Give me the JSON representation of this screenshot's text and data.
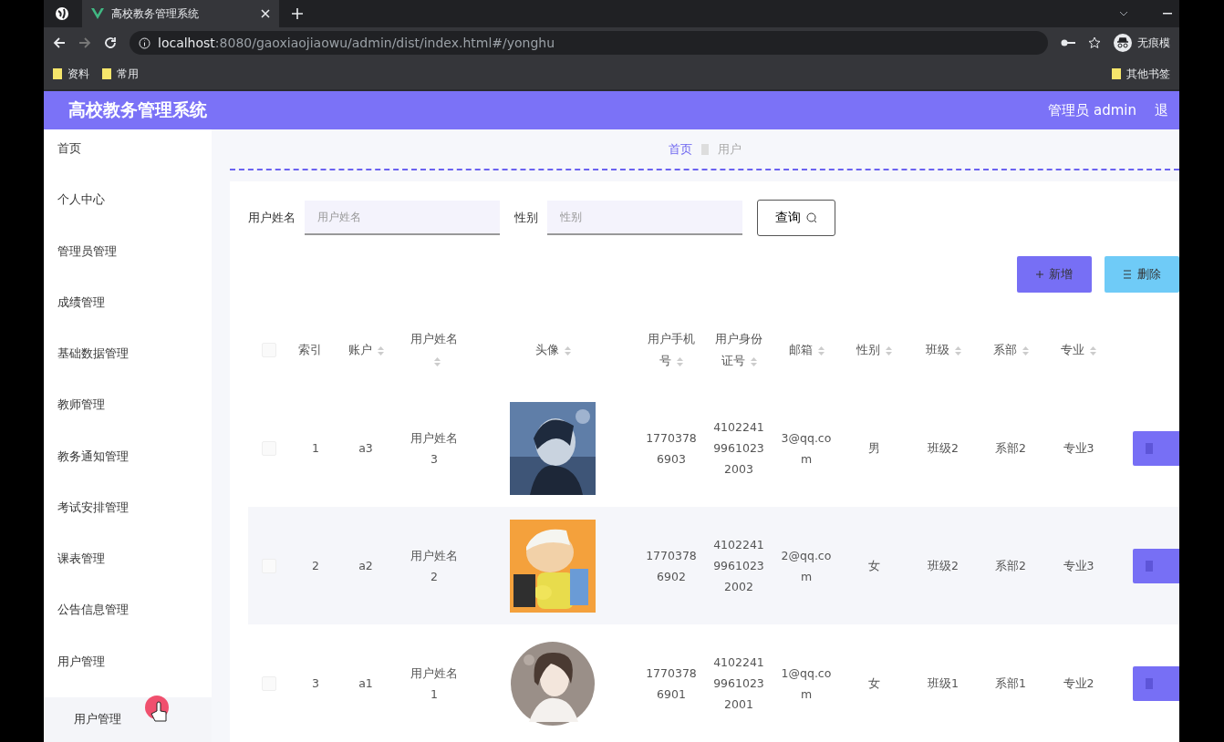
{
  "browser": {
    "tab_title": "高校教务管理系统",
    "url_host": "localhost",
    "url_path": ":8080/gaoxiaojiaowu/admin/dist/index.html#/yonghu",
    "bookmarks": [
      "资料",
      "常用"
    ],
    "other_bookmarks": "其他书签",
    "profile": "无痕模"
  },
  "header": {
    "title": "高校教务管理系统",
    "user": "管理员 admin",
    "logout": "退"
  },
  "sidebar": {
    "items": [
      {
        "label": "首页"
      },
      {
        "label": "个人中心"
      },
      {
        "label": "管理员管理"
      },
      {
        "label": "成绩管理"
      },
      {
        "label": "基础数据管理"
      },
      {
        "label": "教师管理"
      },
      {
        "label": "教务通知管理"
      },
      {
        "label": "考试安排管理"
      },
      {
        "label": "课表管理"
      },
      {
        "label": "公告信息管理"
      },
      {
        "label": "用户管理",
        "children": [
          {
            "label": "用户管理"
          }
        ]
      }
    ]
  },
  "breadcrumb": [
    "首页",
    "用户"
  ],
  "search": {
    "fields": [
      {
        "label": "用户姓名",
        "placeholder": "用户姓名"
      },
      {
        "label": "性别",
        "placeholder": "性别"
      }
    ],
    "button": "查询"
  },
  "actions": [
    {
      "kind": "add",
      "label": "新增"
    },
    {
      "kind": "delete",
      "label": "删除"
    }
  ],
  "table": {
    "header_checked": false,
    "columns": [
      {
        "label": "索引",
        "sortable": false
      },
      {
        "label": "账户",
        "sortable": true
      },
      {
        "label": "用户姓名",
        "sortable": true
      },
      {
        "label": "头像",
        "sortable": true
      },
      {
        "label": "用户手机号",
        "sortable": true
      },
      {
        "label": "用户身份证号",
        "sortable": true
      },
      {
        "label": "邮箱",
        "sortable": true
      },
      {
        "label": "性别",
        "sortable": true
      },
      {
        "label": "班级",
        "sortable": true
      },
      {
        "label": "系部",
        "sortable": true
      },
      {
        "label": "专业",
        "sortable": true
      }
    ],
    "rows": [
      {
        "checked": false,
        "cells": [
          "1",
          "a3",
          "用户姓名3",
          {
            "kind": "picture"
          },
          "17703786903",
          "410224199610232003",
          "3@qq.com",
          "男",
          "班级2",
          "系部2",
          "专业3"
        ]
      },
      {
        "checked": false,
        "cells": [
          "2",
          "a2",
          "用户姓名2",
          {
            "kind": "picture"
          },
          "17703786902",
          "410224199610232002",
          "2@qq.com",
          "女",
          "班级2",
          "系部2",
          "专业3"
        ]
      },
      {
        "checked": false,
        "cells": [
          "3",
          "a1",
          "用户姓名1",
          {
            "kind": "picture"
          },
          "17703786901",
          "410224199610232001",
          "1@qq.com",
          "女",
          "班级1",
          "系部1",
          "专业2"
        ]
      }
    ]
  }
}
